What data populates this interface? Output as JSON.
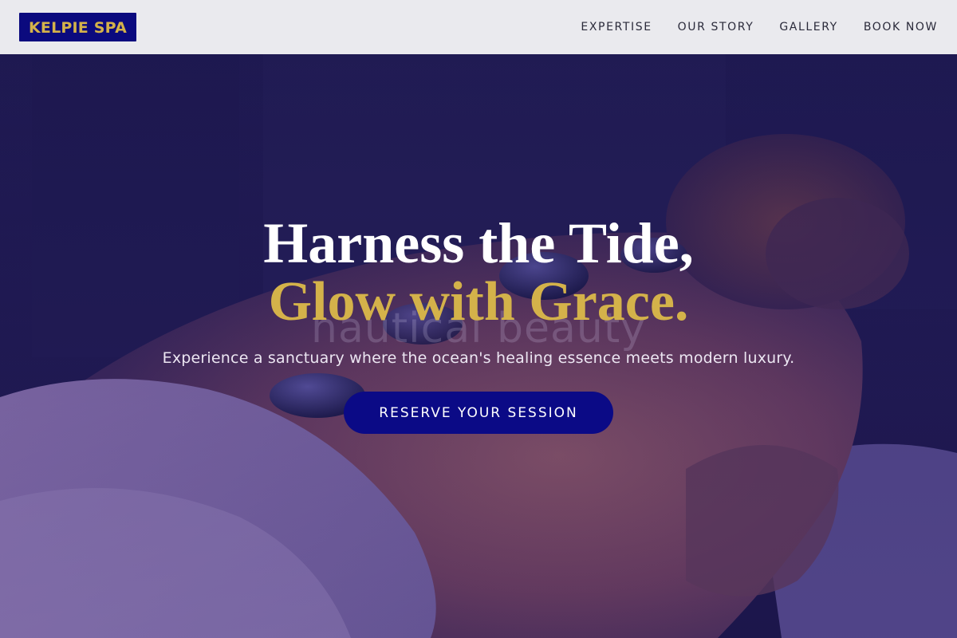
{
  "header": {
    "logo": "KELPIE SPA",
    "nav": [
      "EXPERTISE",
      "OUR STORY",
      "GALLERY",
      "BOOK NOW"
    ]
  },
  "hero": {
    "headline_line1": "Harness the Tide,",
    "headline_line2": "Glow with Grace.",
    "watermark": "nautical beauty",
    "subtitle": "Experience a sanctuary where the ocean's healing essence meets modern luxury.",
    "cta": "RESERVE YOUR SESSION"
  },
  "colors": {
    "brand_navy": "#0b0a7e",
    "brand_gold": "#d4b24a",
    "header_bg": "#eaeaee",
    "hero_tint": "#2a1f6a"
  },
  "icons": []
}
